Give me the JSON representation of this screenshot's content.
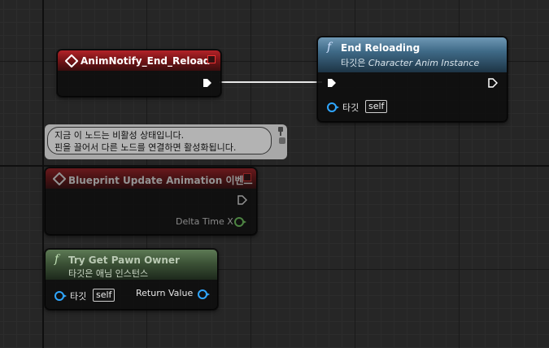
{
  "nodes": {
    "anim_notify": {
      "title": "AnimNotify_End_Reload"
    },
    "end_reloading": {
      "title": "End Reloading",
      "subtitle_prefix": "타깃은 ",
      "subtitle_target": "Character Anim Instance",
      "target_label": "타깃",
      "self_label": "self"
    },
    "blueprint_update": {
      "title": "Blueprint Update Animation 이벤트",
      "delta_label": "Delta Time X"
    },
    "try_get_pawn": {
      "title": "Try Get Pawn Owner",
      "subtitle": "타깃은 애님 인스턴스",
      "target_label": "타깃",
      "self_label": "self",
      "return_label": "Return Value"
    }
  },
  "comment": {
    "line1": "지금 이 노드는 비활성 상태입니다.",
    "line2": "핀을 끌어서 다른 노드를 연결하면 활성화됩니다."
  },
  "colors": {
    "event_header": "#b32228",
    "function_header": "#3f6a87",
    "pure_function_header": "#3c5236",
    "object_pin": "#2fa6ff",
    "float_pin": "#7fe36b"
  }
}
